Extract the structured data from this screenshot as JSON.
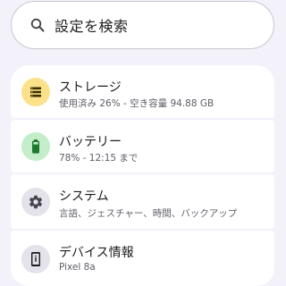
{
  "search": {
    "placeholder": "設定を検索",
    "icon": "search-icon"
  },
  "settings_items": [
    {
      "title": "ストレージ",
      "summary": "使用済み 26% - 空き容量 94.88 GB",
      "icon": "storage-icon",
      "icon_bg": "#fbe28a",
      "icon_color": "#3b2f00"
    },
    {
      "title": "バッテリー",
      "summary": "78% - 12:15 まで",
      "icon": "battery-icon",
      "icon_bg": "#c4eec9",
      "icon_color": "#1f7a2e"
    },
    {
      "title": "システム",
      "summary": "言語、ジェスチャー、時間、バックアップ",
      "icon": "gear-icon",
      "icon_bg": "#e4e2ea",
      "icon_color": "#46464f"
    },
    {
      "title": "デバイス情報",
      "summary": "Pixel 8a",
      "icon": "phone-info-icon",
      "icon_bg": "#e4e2ea",
      "icon_color": "#1c1b1f"
    }
  ]
}
